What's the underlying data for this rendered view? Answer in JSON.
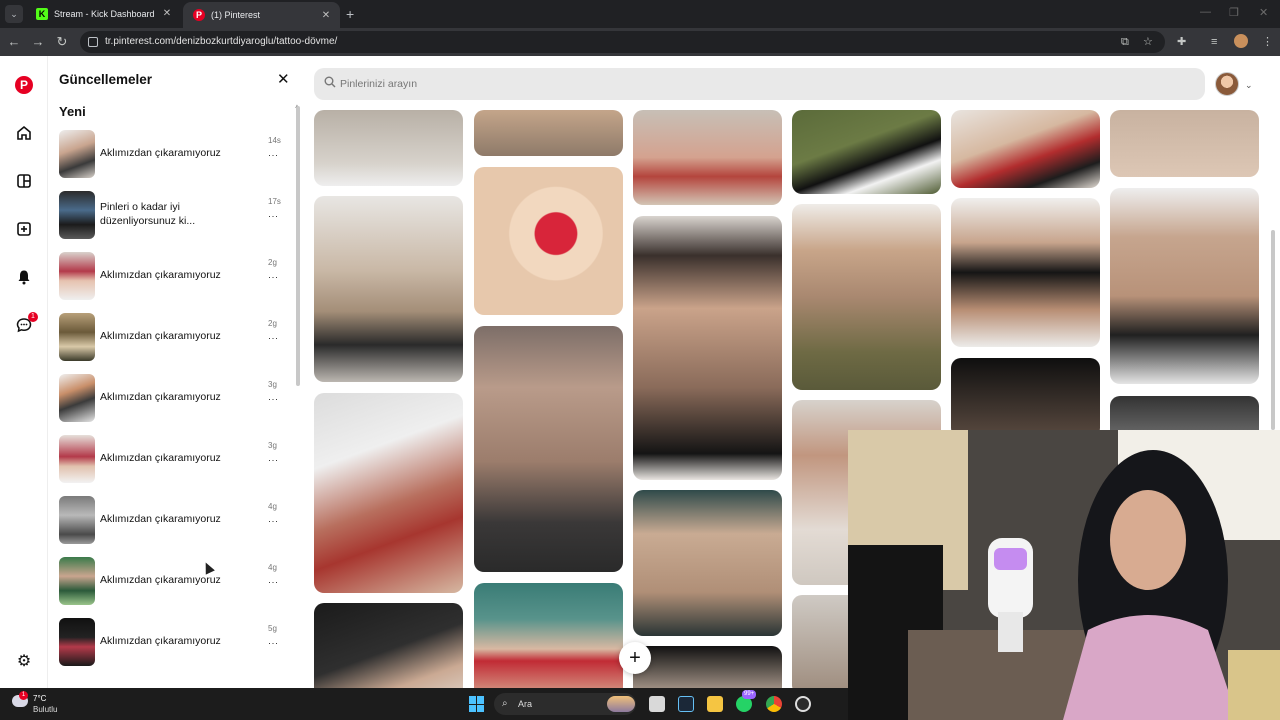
{
  "browser": {
    "tabs": [
      {
        "title": "Stream - Kick Dashboard",
        "favicon": "K"
      },
      {
        "title": "(1) Pinterest",
        "favicon": "P"
      }
    ],
    "new_tab": "+",
    "url": "tr.pinterest.com/denizbozkurtdiyaroglu/tattoo-dövme/"
  },
  "updates": {
    "title": "Güncellemeler",
    "section": "Yeni",
    "items": [
      {
        "text": "Aklımızdan çıkaramıyoruz",
        "time": "14s",
        "more": "···"
      },
      {
        "text": "Pinleri o kadar iyi düzenliyorsunuz ki...",
        "time": "17s",
        "more": "···"
      },
      {
        "text": "Aklımızdan çıkaramıyoruz",
        "time": "2g",
        "more": "···"
      },
      {
        "text": "Aklımızdan çıkaramıyoruz",
        "time": "2g",
        "more": "···"
      },
      {
        "text": "Aklımızdan çıkaramıyoruz",
        "time": "3g",
        "more": "···"
      },
      {
        "text": "Aklımızdan çıkaramıyoruz",
        "time": "3g",
        "more": "···"
      },
      {
        "text": "Aklımızdan çıkaramıyoruz",
        "time": "4g",
        "more": "···"
      },
      {
        "text": "Aklımızdan çıkaramıyoruz",
        "time": "4g",
        "more": "···"
      },
      {
        "text": "Aklımızdan çıkaramıyoruz",
        "time": "5g",
        "more": "···"
      }
    ]
  },
  "search": {
    "placeholder": "Pinlerinizi arayın"
  },
  "rail": {
    "message_badge": "1"
  },
  "fab": {
    "label": "+"
  },
  "taskbar": {
    "weather_temp": "7°C",
    "weather_desc": "Bulutlu",
    "weather_badge": "1",
    "search_label": "Ara",
    "whatsapp_badge": "99+"
  },
  "colors": {
    "pinterest_red": "#e60023",
    "chrome_dark": "#202124",
    "search_bg": "#e9e9e9"
  }
}
